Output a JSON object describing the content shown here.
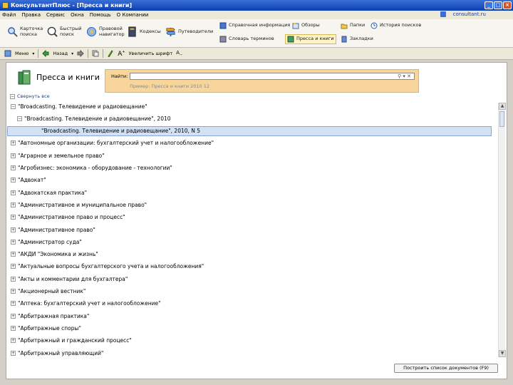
{
  "window": {
    "title": "КонсультантПлюс - [Пресса и книги]"
  },
  "menu": [
    "Файл",
    "Правка",
    "Сервис",
    "Окна",
    "Помощь",
    "О Компании"
  ],
  "menu_site": "consultant.ru",
  "ribbon": {
    "card_search": "Карточка поиска",
    "quick_search": "Быстрый поиск",
    "legal_navigator": "Правовой навигатор",
    "codexes": "Кодексы",
    "guides": "Путеводители",
    "reference_info": "Справочная информация",
    "reviews": "Обзоры",
    "term_dictionary": "Словарь терминов",
    "press_books": "Пресса и книги",
    "folders": "Папки",
    "search_history": "История поисков",
    "bookmarks": "Закладки"
  },
  "toolbar2": {
    "menu": "Меню",
    "back": "Назад",
    "zoom": "Увеличить шрифт"
  },
  "page": {
    "title": "Пресса и книги",
    "search_label": "Найти:",
    "search_value": "",
    "search_hint": "Пример: Пресса и книги 2010 12",
    "collapse_all": "Свернуть все",
    "bottom_button": "Построить список документов (F9)"
  },
  "tree": [
    {
      "text": "\"Broadcasting. Телевидение и радиовещание\"",
      "toggle": "−",
      "indent": 0,
      "selected": false
    },
    {
      "text": "\"Broadcasting. Телевидение и радиовещание\", 2010",
      "toggle": "−",
      "indent": 1,
      "selected": false
    },
    {
      "text": "\"Broadcasting. Телевидение и радиовещание\", 2010, N 5",
      "toggle": "",
      "indent": 2,
      "selected": true
    },
    {
      "text": "\"Автономные организации: бухгалтерский учет и налогообложение\"",
      "toggle": "+",
      "indent": 0,
      "selected": false
    },
    {
      "text": "\"Аграрное и земельное право\"",
      "toggle": "+",
      "indent": 0,
      "selected": false
    },
    {
      "text": "\"Агробизнес: экономика - оборудование - технологии\"",
      "toggle": "+",
      "indent": 0,
      "selected": false
    },
    {
      "text": "\"Адвокат\"",
      "toggle": "+",
      "indent": 0,
      "selected": false
    },
    {
      "text": "\"Адвокатская практика\"",
      "toggle": "+",
      "indent": 0,
      "selected": false
    },
    {
      "text": "\"Административное и муниципальное право\"",
      "toggle": "+",
      "indent": 0,
      "selected": false
    },
    {
      "text": "\"Административное право и процесс\"",
      "toggle": "+",
      "indent": 0,
      "selected": false
    },
    {
      "text": "\"Административное право\"",
      "toggle": "+",
      "indent": 0,
      "selected": false
    },
    {
      "text": "\"Администратор суда\"",
      "toggle": "+",
      "indent": 0,
      "selected": false
    },
    {
      "text": "\"АКДИ \"Экономика и жизнь\"",
      "toggle": "+",
      "indent": 0,
      "selected": false
    },
    {
      "text": "\"Актуальные вопросы бухгалтерского учета и налогообложения\"",
      "toggle": "+",
      "indent": 0,
      "selected": false
    },
    {
      "text": "\"Акты и комментарии для бухгалтера\"",
      "toggle": "+",
      "indent": 0,
      "selected": false
    },
    {
      "text": "\"Акционерный вестник\"",
      "toggle": "+",
      "indent": 0,
      "selected": false
    },
    {
      "text": "\"Аптека: бухгалтерский учет и налогообложение\"",
      "toggle": "+",
      "indent": 0,
      "selected": false
    },
    {
      "text": "\"Арбитражная практика\"",
      "toggle": "+",
      "indent": 0,
      "selected": false
    },
    {
      "text": "\"Арбитражные споры\"",
      "toggle": "+",
      "indent": 0,
      "selected": false
    },
    {
      "text": "\"Арбитражный и гражданский процесс\"",
      "toggle": "+",
      "indent": 0,
      "selected": false
    },
    {
      "text": "\"Арбитражный управляющий\"",
      "toggle": "+",
      "indent": 0,
      "selected": false
    }
  ]
}
